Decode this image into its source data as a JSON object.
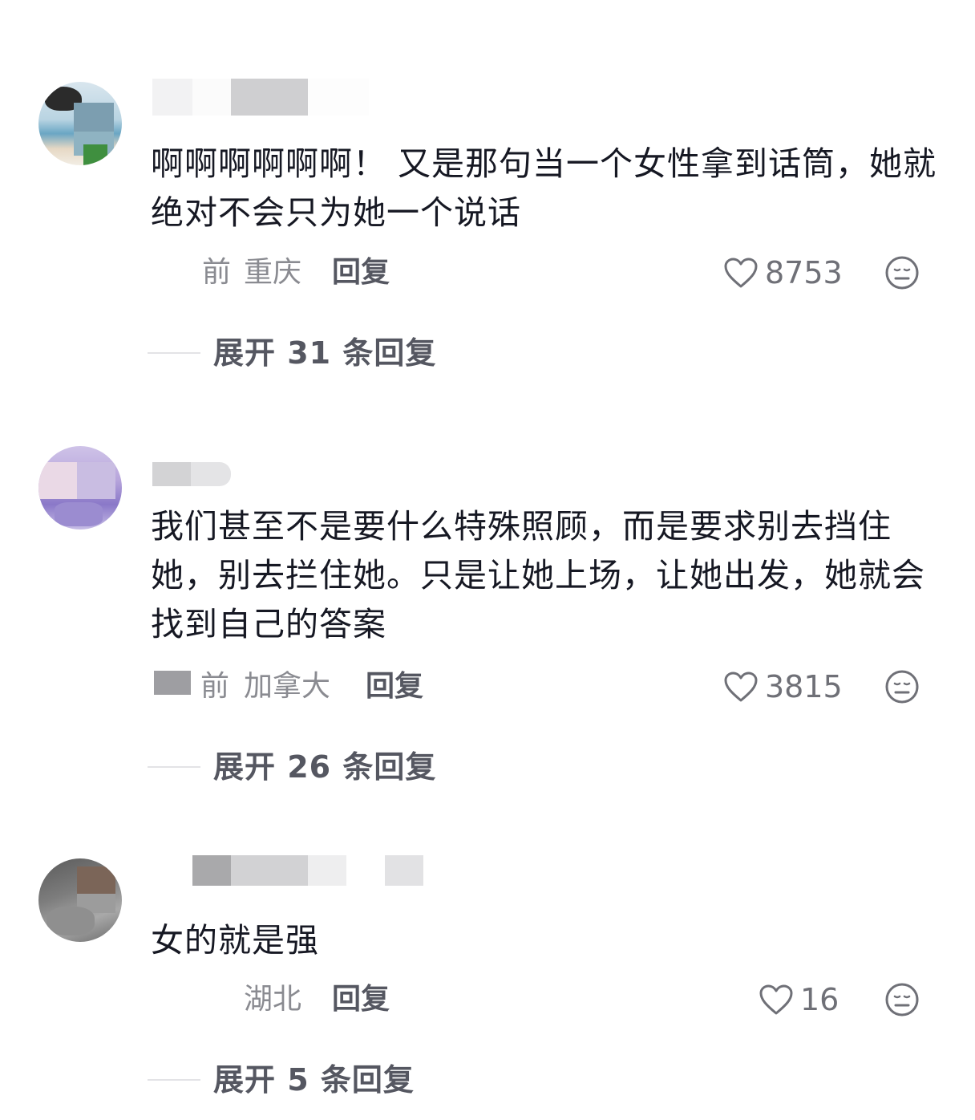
{
  "comments": [
    {
      "text": "啊啊啊啊啊啊！ 又是那句当一个女性拿到话筒，她就绝对不会只为她一个说话",
      "time": "前",
      "location": "重庆",
      "reply_label": "回复",
      "likes": "8753",
      "expand_label": "展开 31 条回复"
    },
    {
      "text": "我们甚至不是要什么特殊照顾，而是要求别去挡住她，别去拦住她。只是让她上场，让她出发，她就会找到自己的答案",
      "time": "前",
      "location": "加拿大",
      "reply_label": "回复",
      "likes": "3815",
      "expand_label": "展开 26 条回复"
    },
    {
      "text": "女的就是强",
      "time": "",
      "location": "湖北",
      "reply_label": "回复",
      "likes": "16",
      "expand_label": "展开 5 条回复"
    }
  ],
  "icons": {
    "like": "heart-outline-icon",
    "dislike": "meh-face-icon"
  },
  "colors": {
    "text": "#161823",
    "secondary": "#8a8b91",
    "reply": "#555761"
  }
}
